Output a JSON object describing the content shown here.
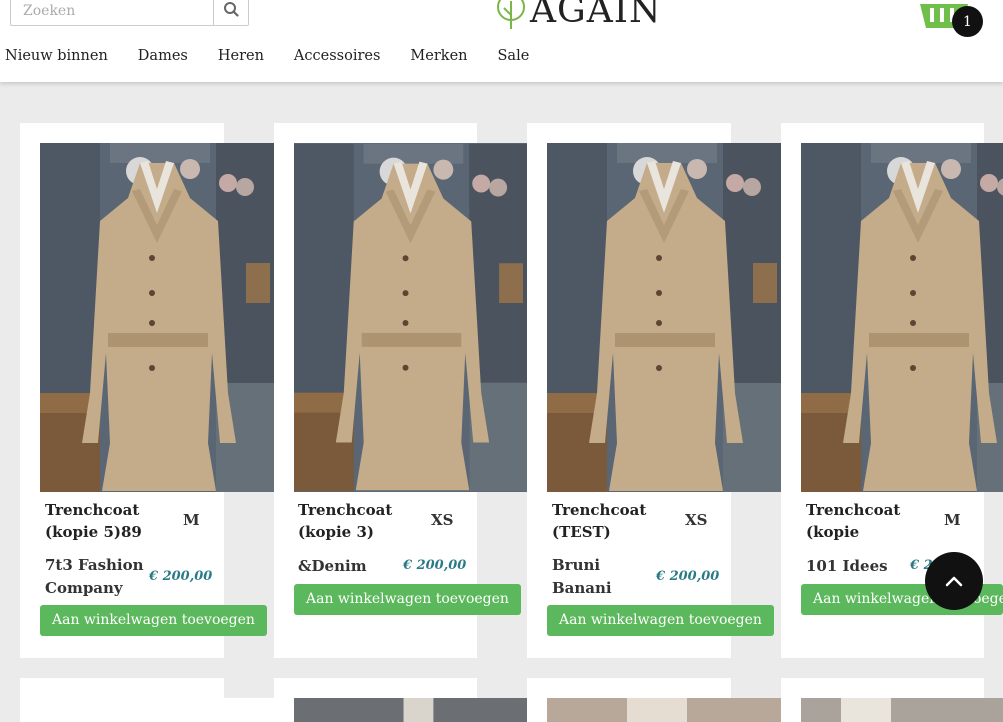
{
  "search": {
    "placeholder": "Zoeken",
    "icon": "search-icon"
  },
  "logo": {
    "text": "AGAIN"
  },
  "cart": {
    "count": "1",
    "icon": "basket-icon",
    "color": "#6fbf4a"
  },
  "nav": {
    "items": [
      "Nieuw binnen",
      "Dames",
      "Heren",
      "Accessoires",
      "Merken",
      "Sale"
    ]
  },
  "products": [
    {
      "name_line1": "Trenchcoat",
      "name_line2": "(kopie 5)89",
      "size": "M",
      "brand_line1": "7t3 Fashion",
      "brand_line2": "Company",
      "price": "€ 200,00",
      "button": "Aan winkelwagen toevoegen"
    },
    {
      "name_line1": "Trenchcoat",
      "name_line2": "(kopie 3)",
      "size": "XS",
      "brand_line1": "&Denim",
      "brand_line2": "",
      "price": "€ 200,00",
      "button": "Aan winkelwagen toevoegen"
    },
    {
      "name_line1": "Trenchcoat",
      "name_line2": "(TEST)",
      "size": "XS",
      "brand_line1": "Bruni",
      "brand_line2": "Banani",
      "price": "€ 200,00",
      "button": "Aan winkelwagen toevoegen"
    },
    {
      "name_line1": "Trenchcoat",
      "name_line2": "(kopie",
      "size": "M",
      "brand_line1": "101 Idees",
      "brand_line2": "",
      "price": "€ 2",
      "button": "Aan winkelwagen toevoegen"
    }
  ],
  "colors": {
    "accent_button": "#5cb85c",
    "price": "#2a7a86"
  },
  "scroll_top": {
    "icon": "chevron-up-icon"
  }
}
